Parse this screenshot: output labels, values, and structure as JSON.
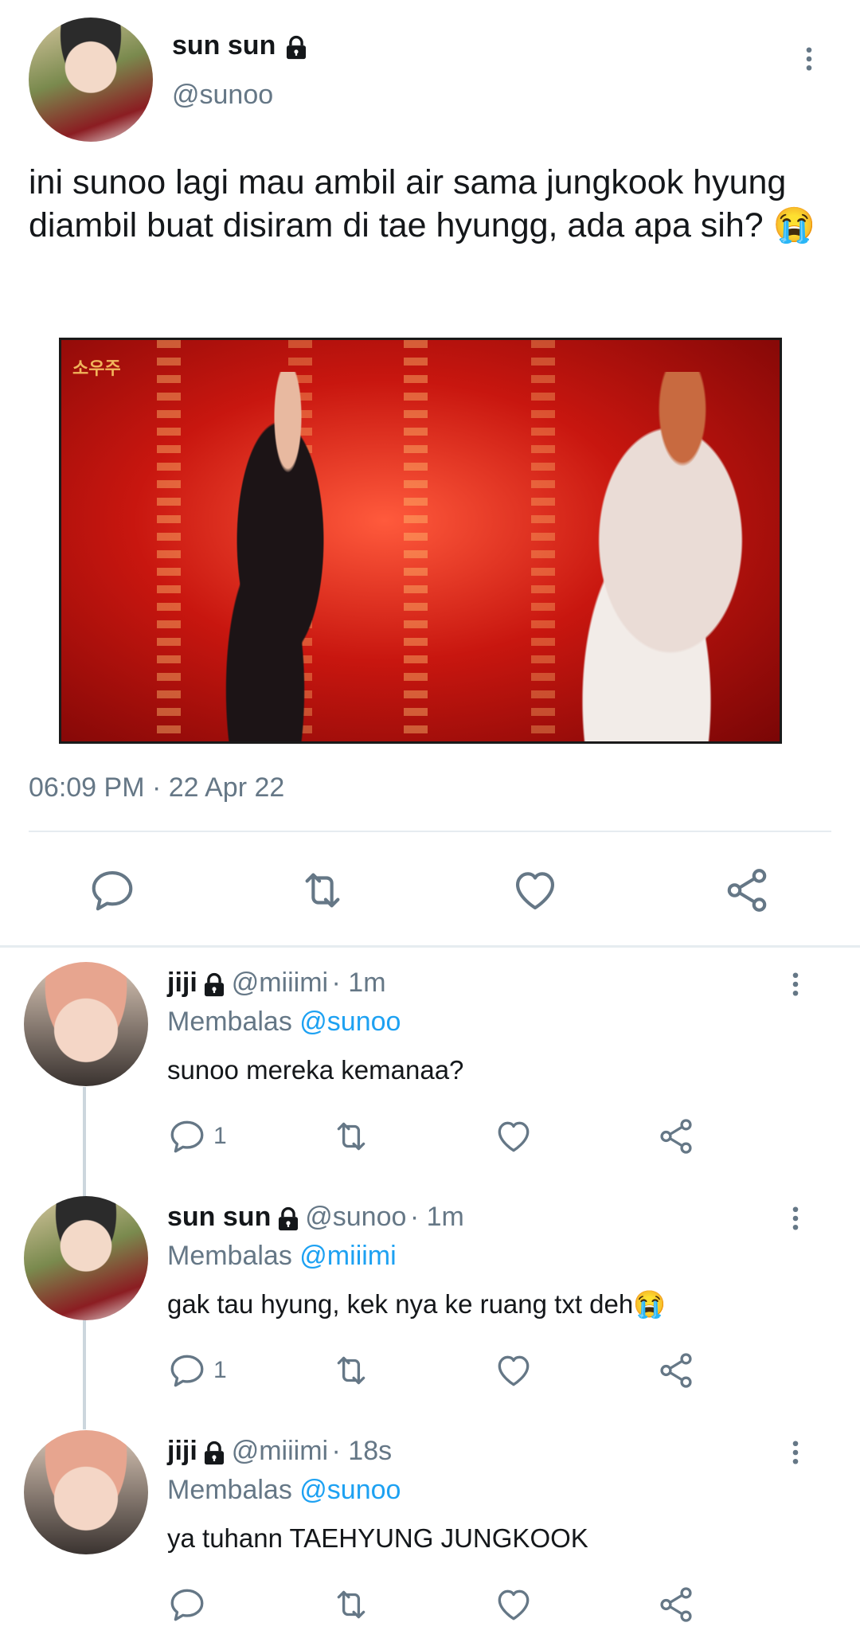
{
  "main_tweet": {
    "display_name": "sun sun",
    "handle": "@sunoo",
    "text": "ini sunoo lagi mau ambil air sama jungkook hyung diambil buat disiram di tae hyungg, ada apa sih? 😭",
    "timestamp": "06:09 PM · 22 Apr 22",
    "media_label": "소우주"
  },
  "replies": [
    {
      "display_name": "jiji",
      "handle": "@miiimi",
      "time": "· 1m",
      "replying_prefix": "Membalas",
      "replying_to": "@sunoo",
      "text": "sunoo mereka kemanaa?",
      "reply_count": "1"
    },
    {
      "display_name": "sun sun",
      "handle": "@sunoo",
      "time": "· 1m",
      "replying_prefix": "Membalas",
      "replying_to": "@miiimi",
      "text": "gak tau hyung, kek nya ke ruang txt deh😭",
      "reply_count": "1"
    },
    {
      "display_name": "jiji",
      "handle": "@miiimi",
      "time": "· 18s",
      "replying_prefix": "Membalas",
      "replying_to": "@sunoo",
      "text": "ya tuhann TAEHYUNG JUNGKOOK",
      "reply_count": ""
    }
  ],
  "icons": {
    "reply": "comment-icon",
    "retweet": "retweet-icon",
    "like": "heart-icon",
    "share": "share-icon",
    "more": "more-vertical-icon",
    "lock": "lock-icon"
  },
  "colors": {
    "link": "#1da1f2",
    "secondary_text": "#657786",
    "icon": "#657786"
  }
}
